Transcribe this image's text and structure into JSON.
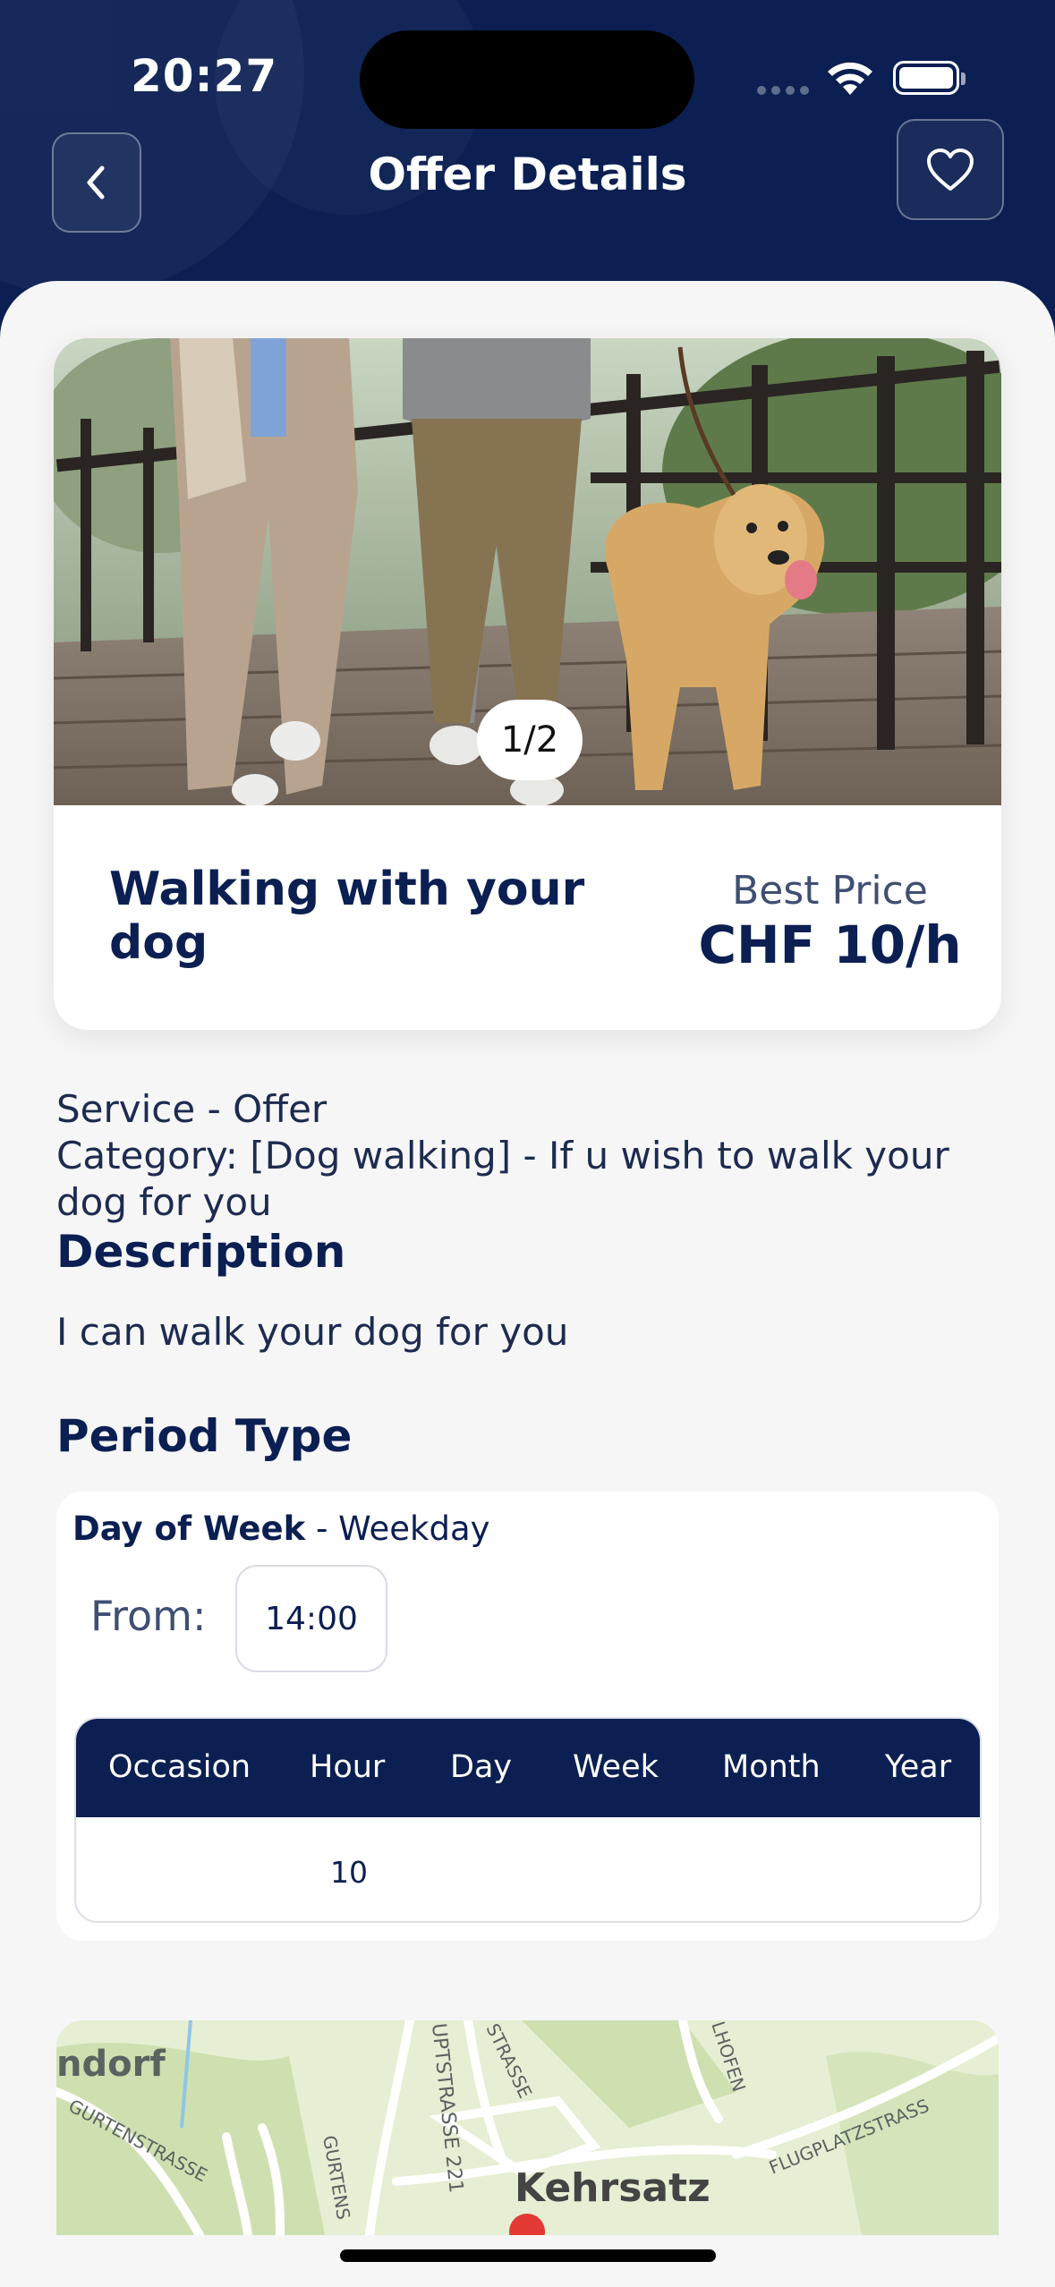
{
  "status_bar": {
    "time": "20:27"
  },
  "header": {
    "title": "Offer Details",
    "back_icon": "chevron-left-icon",
    "favorite_icon": "heart-outline-icon"
  },
  "offer": {
    "image_counter": "1/2",
    "title": "Walking with your dog",
    "price_label": "Best Price",
    "price_value": "CHF 10/h"
  },
  "info": {
    "service_line": "Service - Offer",
    "category_line": "Category: [Dog walking] - If u wish to walk your dog for you"
  },
  "description": {
    "heading": "Description",
    "text": "I can walk your dog for you"
  },
  "period": {
    "heading": "Period Type",
    "day_of_week_label": "Day of Week",
    "day_of_week_value": " - Weekday",
    "from_label": "From:",
    "from_value": "14:00",
    "table_headers": [
      "Occasion",
      "Hour",
      "Day",
      "Week",
      "Month",
      "Year"
    ],
    "table_values": [
      "",
      "10",
      "",
      "",
      "",
      ""
    ]
  },
  "map": {
    "town_label": "Kehrsatz",
    "partial_label": "ndorf",
    "street_labels": [
      "GURTENSTRASSE",
      "GURTENS",
      "UPTSTRASSE 221",
      "STRASSE",
      "LHOFEN",
      "FLUGPLATZSTRASS"
    ]
  },
  "colors": {
    "navy": "#0b1f52",
    "background": "#f6f6f7",
    "accent_marker": "#e53935"
  }
}
